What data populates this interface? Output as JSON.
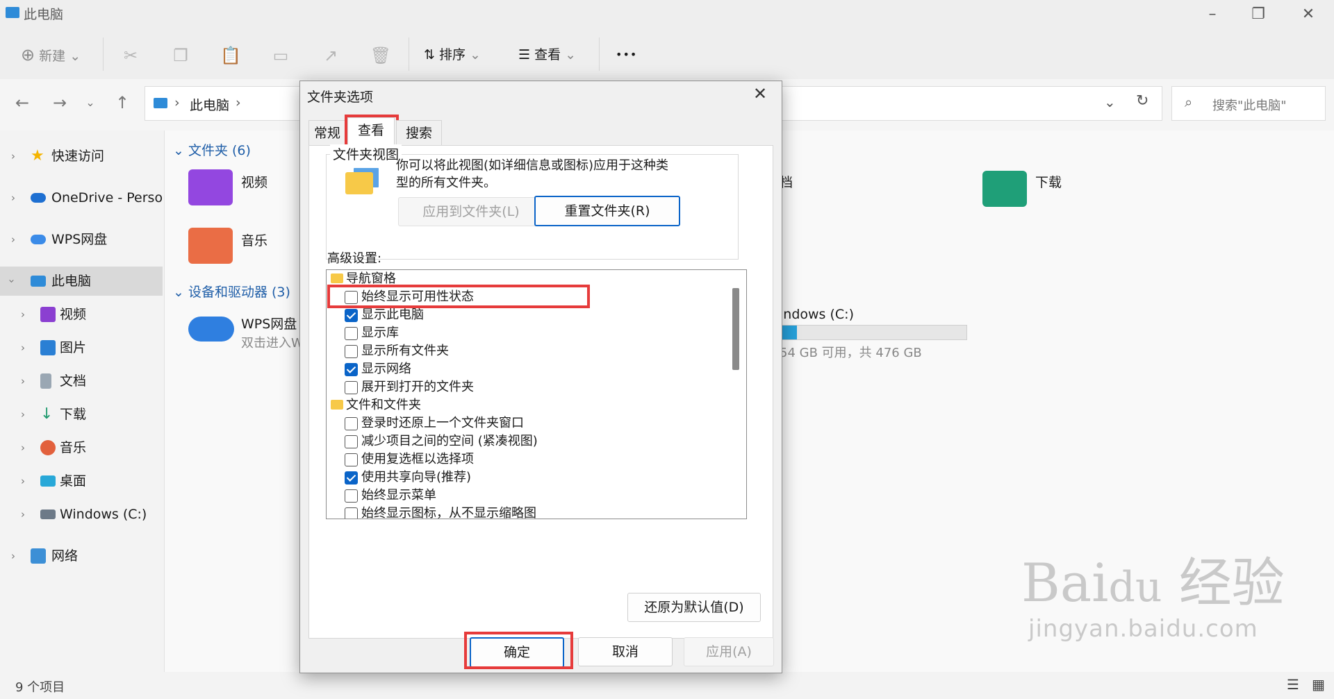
{
  "explorer": {
    "window_title": "此电脑",
    "toolbar": {
      "new_label": "新建",
      "sort_label": "排序",
      "view_label": "查看",
      "more_label": "•••"
    },
    "address": {
      "crumb": "此电脑",
      "search_placeholder": "搜索\"此电脑\""
    },
    "sidebar": {
      "items": [
        {
          "label": "快速访问"
        },
        {
          "label": "OneDrive - Persona"
        },
        {
          "label": "WPS网盘"
        },
        {
          "label": "此电脑"
        },
        {
          "label": "视频"
        },
        {
          "label": "图片"
        },
        {
          "label": "文档"
        },
        {
          "label": "下载"
        },
        {
          "label": "音乐"
        },
        {
          "label": "桌面"
        },
        {
          "label": "Windows (C:)"
        },
        {
          "label": "网络"
        }
      ]
    },
    "main": {
      "folders_header": "文件夹 (6)",
      "folders": [
        "视频",
        "音乐",
        "档",
        "下载"
      ],
      "devices_header": "设备和驱动器 (3)",
      "wps_name": "WPS网盘",
      "wps_sub": "双击进入W",
      "drive_name": "indows (C:)",
      "drive_sub": "54 GB 可用，共 476 GB",
      "drive_used_fraction": 0.09
    },
    "status": "9 个项目"
  },
  "dialog": {
    "title": "文件夹选项",
    "tabs": [
      "常规",
      "查看",
      "搜索"
    ],
    "group_title": "文件夹视图",
    "group_desc": "你可以将此视图(如详细信息或图标)应用于这种类型的所有文件夹。",
    "apply_to_folders": "应用到文件夹(L)",
    "reset_folders": "重置文件夹(R)",
    "advanced_label": "高级设置:",
    "list": [
      {
        "type": "folder",
        "label": "导航窗格"
      },
      {
        "type": "check",
        "label": "始终显示可用性状态",
        "checked": false
      },
      {
        "type": "check",
        "label": "显示此电脑",
        "checked": true
      },
      {
        "type": "check",
        "label": "显示库",
        "checked": false
      },
      {
        "type": "check",
        "label": "显示所有文件夹",
        "checked": false
      },
      {
        "type": "check",
        "label": "显示网络",
        "checked": true
      },
      {
        "type": "check",
        "label": "展开到打开的文件夹",
        "checked": false
      },
      {
        "type": "folder",
        "label": "文件和文件夹"
      },
      {
        "type": "check",
        "label": "登录时还原上一个文件夹窗口",
        "checked": false
      },
      {
        "type": "check",
        "label": "减少项目之间的空间 (紧凑视图)",
        "checked": false
      },
      {
        "type": "check",
        "label": "使用复选框以选择项",
        "checked": false
      },
      {
        "type": "check",
        "label": "使用共享向导(推荐)",
        "checked": true
      },
      {
        "type": "check",
        "label": "始终显示菜单",
        "checked": false
      },
      {
        "type": "check",
        "label": "始终显示图标，从不显示缩略图",
        "checked": false
      }
    ],
    "restore_defaults": "还原为默认值(D)",
    "ok": "确定",
    "cancel": "取消",
    "apply": "应用(A)"
  },
  "watermark": {
    "brand": "Bai du 经验",
    "url": "jingyan.baidu.com"
  }
}
